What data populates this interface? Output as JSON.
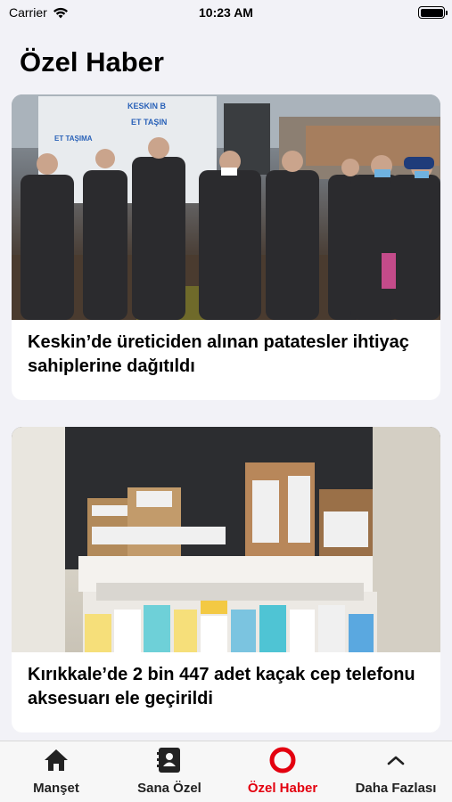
{
  "status_bar": {
    "carrier": "Carrier",
    "time": "10:23 AM"
  },
  "page": {
    "title": "Özel Haber"
  },
  "articles": [
    {
      "title": "Keskin’de üreticiden alınan patatesler ihtiyaç sahiplerine dağıtıldı"
    },
    {
      "title": "Kırıkkale’de 2 bin 447 adet kaçak cep telefonu aksesuarı ele geçirildi"
    }
  ],
  "tab_bar": {
    "tabs": [
      {
        "label": "Manşet",
        "icon": "home-icon"
      },
      {
        "label": "Sana Özel",
        "icon": "contact-book-icon"
      },
      {
        "label": "Özel Haber",
        "icon": "ring-icon",
        "active": true
      },
      {
        "label": "Daha Fazlası",
        "icon": "chevron-up-icon"
      }
    ],
    "active_color": "#e3000f"
  }
}
